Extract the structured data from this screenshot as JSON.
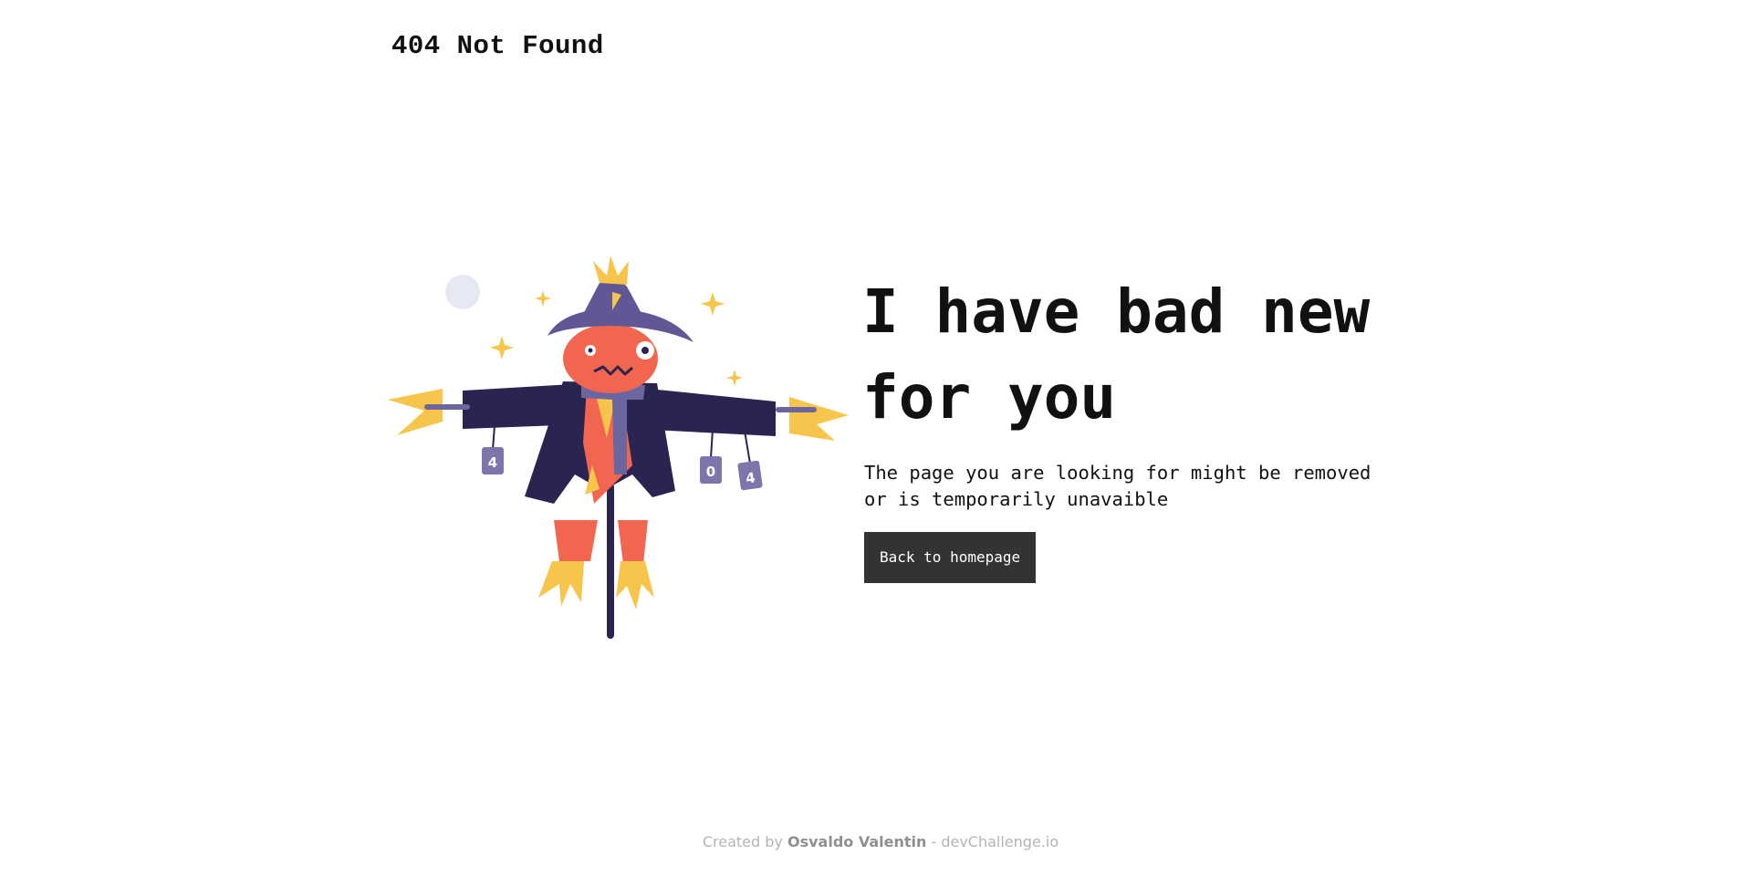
{
  "header": {
    "logo_text": "404 Not Found"
  },
  "illustration": {
    "can_labels": [
      "4",
      "0",
      "4"
    ],
    "colors": {
      "coat": "#2a2550",
      "hat": "#5f5894",
      "scarf": "#6c669f",
      "face": "#f2664f",
      "straw": "#f7c54b",
      "can": "#7c76ad",
      "moon": "#e6e8f4"
    }
  },
  "main": {
    "headline": "I have bad new for you",
    "message": "The page you are looking for might be removed or is temporarily unavaible",
    "button_label": "Back to homepage"
  },
  "footer": {
    "prefix": "Created by ",
    "author": "Osvaldo Valentin",
    "suffix": " - devChallenge.io"
  }
}
